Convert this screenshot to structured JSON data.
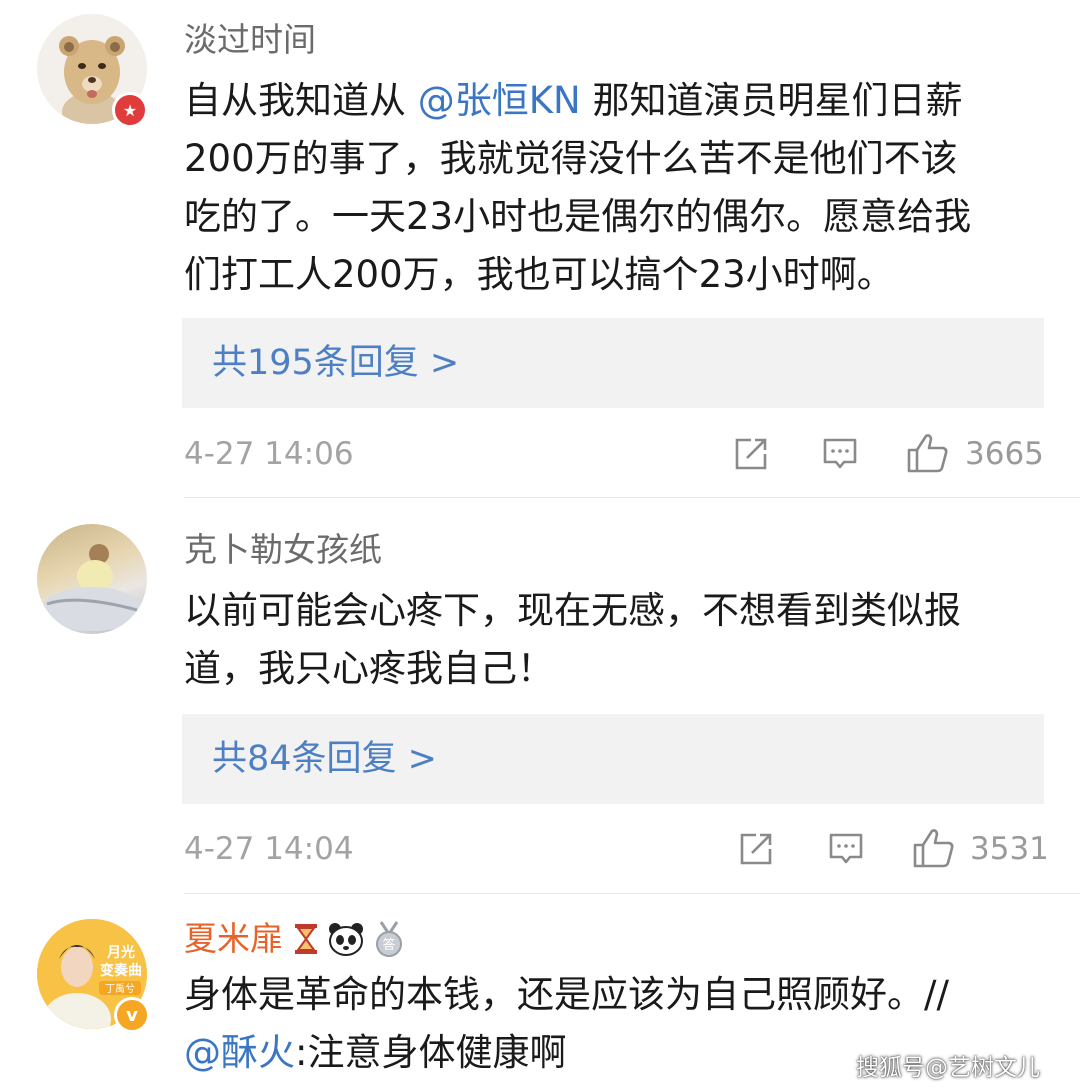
{
  "comments": [
    {
      "username": "淡过时间",
      "lines": [
        "自从我知道从 ",
        "那知道演员明星们日薪",
        "200万的事了，我就觉得没什么苦不是他们不该",
        "吃的了。一天23小时也是偶尔的偶尔。愿意给我",
        "们打工人200万，我也可以搞个23小时啊。"
      ],
      "mention": "@张恒KN",
      "reply_text": "共195条回复 >",
      "timestamp": "4-27 14:06",
      "likes": "3665"
    },
    {
      "username": "克卜勒女孩纸",
      "lines": [
        "以前可能会心疼下，现在无感，不想看到类似报",
        "道，我只心疼我自己！"
      ],
      "reply_text": "共84条回复 >",
      "timestamp": "4-27 14:04",
      "likes": "3531"
    },
    {
      "username": "夏米扉",
      "username_color": "#e8632a",
      "avatar_text": [
        "月光",
        "变奏曲"
      ],
      "lines": [
        "身体是革命的本钱，还是应该为自己照顾好。//",
        ":注意身体健康啊"
      ],
      "mention": "@酥火"
    }
  ],
  "watermark": "搜狐号@艺树文儿",
  "icons": [
    "share-icon",
    "comment-icon",
    "like-icon",
    "lion-avatar",
    "verified-badge",
    "hourglass-badge-icon",
    "panda-badge-icon",
    "medal-badge-icon"
  ],
  "colors": {
    "accent_link": "#4d7fc4",
    "mention": "#3a76c4",
    "badge_red": "#e03c3c",
    "badge_orange": "#f5a623",
    "reply_bg": "#f2f2f2"
  }
}
